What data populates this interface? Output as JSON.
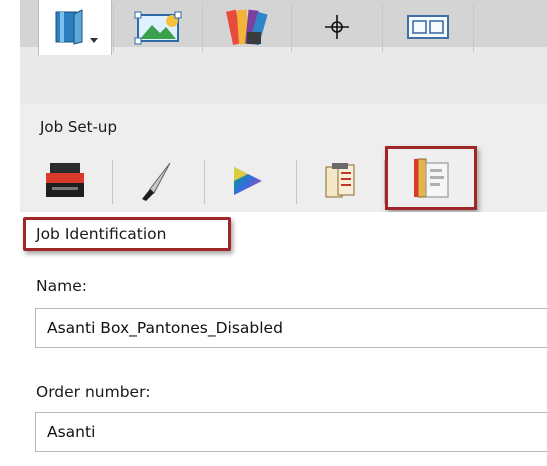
{
  "section": {
    "title": "Job Set-up"
  },
  "toolbar_top": {
    "items": [
      {
        "id": "book",
        "icon": "book-icon",
        "selected": true
      },
      {
        "id": "image",
        "icon": "image-edit-icon",
        "selected": false
      },
      {
        "id": "swatches",
        "icon": "color-swatches-icon",
        "selected": false
      },
      {
        "id": "crosshair",
        "icon": "crosshair-icon",
        "selected": false
      },
      {
        "id": "layout",
        "icon": "layout-frame-icon",
        "selected": false
      }
    ]
  },
  "toolbar_sub": {
    "items": [
      {
        "id": "printer",
        "icon": "printer-icon",
        "selected": false
      },
      {
        "id": "knife",
        "icon": "knife-icon",
        "selected": false
      },
      {
        "id": "color",
        "icon": "color-triangle-icon",
        "selected": false
      },
      {
        "id": "checklist",
        "icon": "checklist-icon",
        "selected": false
      },
      {
        "id": "job-doc",
        "icon": "job-document-icon",
        "selected": true
      }
    ]
  },
  "job_identification": {
    "title": "Job Identification",
    "name_label": "Name:",
    "name_value": "Asanti Box_Pantones_Disabled",
    "order_label": "Order number:",
    "order_value": "Asanti"
  },
  "colors": {
    "highlight": "#a0262a"
  }
}
